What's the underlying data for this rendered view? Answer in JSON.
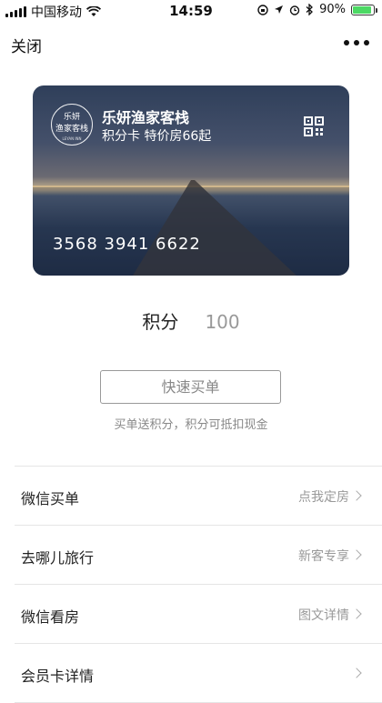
{
  "status_bar": {
    "carrier": "中国移动",
    "time": "14:59",
    "battery": "90%",
    "battery_level": 0.9,
    "icons": [
      "signal-icon",
      "wifi-icon",
      "lock-rotation-icon",
      "location-icon",
      "alarm-icon",
      "bluetooth-icon",
      "battery-icon"
    ]
  },
  "nav": {
    "close_label": "关闭",
    "more_icon": "more-icon"
  },
  "card": {
    "logo_line1": "乐妍",
    "logo_line2": "渔家客栈",
    "logo_small": "LEYAN INN",
    "title": "乐妍渔家客栈",
    "subtitle": "积分卡 特价房66起",
    "number": "3568 3941 6622",
    "qr_icon": "qr-code-icon"
  },
  "points": {
    "label": "积分",
    "value": "100"
  },
  "quick_buy": {
    "label": "快速买单"
  },
  "hint": "买单送积分，积分可抵扣现金",
  "list": [
    {
      "label": "微信买单",
      "right": "点我定房"
    },
    {
      "label": "去哪儿旅行",
      "right": "新客专享"
    },
    {
      "label": "微信看房",
      "right": "图文详情"
    },
    {
      "label": "会员卡详情",
      "right": ""
    }
  ],
  "colors": {
    "battery": "#4cd964",
    "text_secondary": "#999999",
    "divider": "#e5e5e5"
  }
}
